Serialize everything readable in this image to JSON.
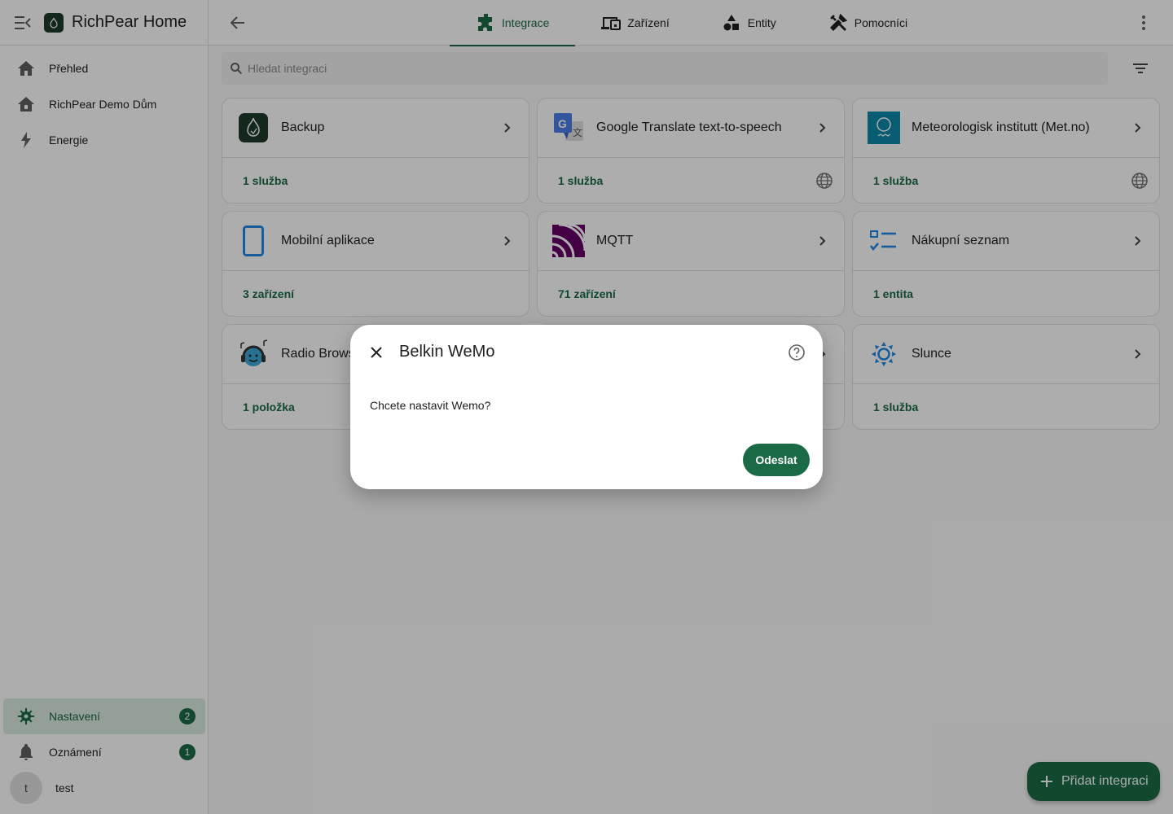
{
  "app": {
    "title": "RichPear Home"
  },
  "sidebar": {
    "items": [
      {
        "label": "Přehled",
        "icon": "home-icon"
      },
      {
        "label": "RichPear Demo Dům",
        "icon": "home-outline-icon"
      },
      {
        "label": "Energie",
        "icon": "lightning-icon"
      }
    ],
    "bottom": [
      {
        "label": "Nastavení",
        "icon": "gear-icon",
        "badge": "2"
      },
      {
        "label": "Oznámení",
        "icon": "bell-icon",
        "badge": "1"
      }
    ],
    "user": {
      "initial": "t",
      "name": "test"
    }
  },
  "tabs": [
    {
      "label": "Integrace",
      "icon": "puzzle-icon"
    },
    {
      "label": "Zařízení",
      "icon": "devices-icon"
    },
    {
      "label": "Entity",
      "icon": "shapes-icon"
    },
    {
      "label": "Pomocníci",
      "icon": "tools-icon"
    }
  ],
  "search": {
    "placeholder": "Hledat integraci"
  },
  "integrations": [
    {
      "name": "Backup",
      "count": "1 služba",
      "globe": false
    },
    {
      "name": "Google Translate text-to-speech",
      "count": "1 služba",
      "globe": true
    },
    {
      "name": "Meteorologisk institutt (Met.no)",
      "count": "1 služba",
      "globe": true
    },
    {
      "name": "Mobilní aplikace",
      "count": "3 zařízení",
      "globe": false
    },
    {
      "name": "MQTT",
      "count": "71 zařízení",
      "globe": false
    },
    {
      "name": "Nákupní seznam",
      "count": "1 entita",
      "globe": false
    },
    {
      "name": "Radio Browser",
      "count": "1 položka",
      "globe": false
    },
    {
      "name": "",
      "count": "",
      "globe": false
    },
    {
      "name": "Slunce",
      "count": "1 služba",
      "globe": false
    }
  ],
  "fab": {
    "label": "Přidat integraci"
  },
  "dialog": {
    "title": "Belkin WeMo",
    "text": "Chcete nastavit Wemo?",
    "submit": "Odeslat"
  },
  "colors": {
    "accent": "#1a6b45",
    "active_bg": "#dbeadf",
    "scrim": "rgba(0,0,0,0.32)"
  }
}
